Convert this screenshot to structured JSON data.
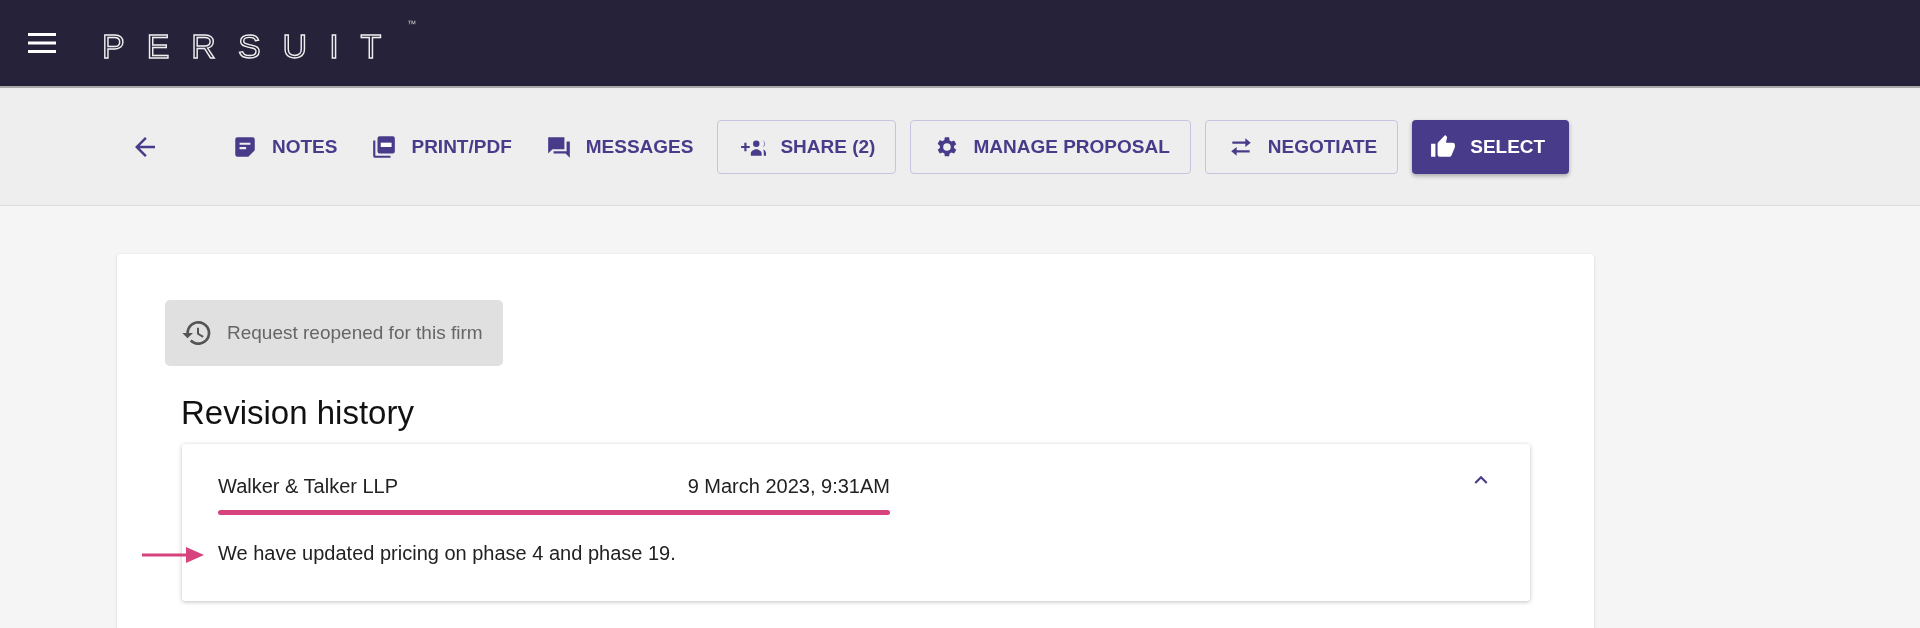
{
  "app_bar": {
    "logo": "PERSUIT",
    "trademark": "™"
  },
  "toolbar": {
    "actions": [
      {
        "label": "NOTES",
        "kind": "text"
      },
      {
        "label": "PRINT/PDF",
        "kind": "text"
      },
      {
        "label": "MESSAGES",
        "kind": "text"
      },
      {
        "label": "SHARE (2)",
        "kind": "outlined"
      },
      {
        "label": "MANAGE PROPOSAL",
        "kind": "outlined"
      },
      {
        "label": "NEGOTIATE",
        "kind": "outlined"
      },
      {
        "label": "SELECT",
        "kind": "primary"
      }
    ]
  },
  "status_chip": {
    "label": "Request reopened for this firm"
  },
  "revision_history": {
    "title": "Revision history",
    "entries": [
      {
        "firm": "Walker & Talker LLP",
        "date": "9 March 2023, 9:31AM",
        "expanded": true,
        "message": "We have updated pricing on phase 4 and phase 19."
      }
    ]
  }
}
